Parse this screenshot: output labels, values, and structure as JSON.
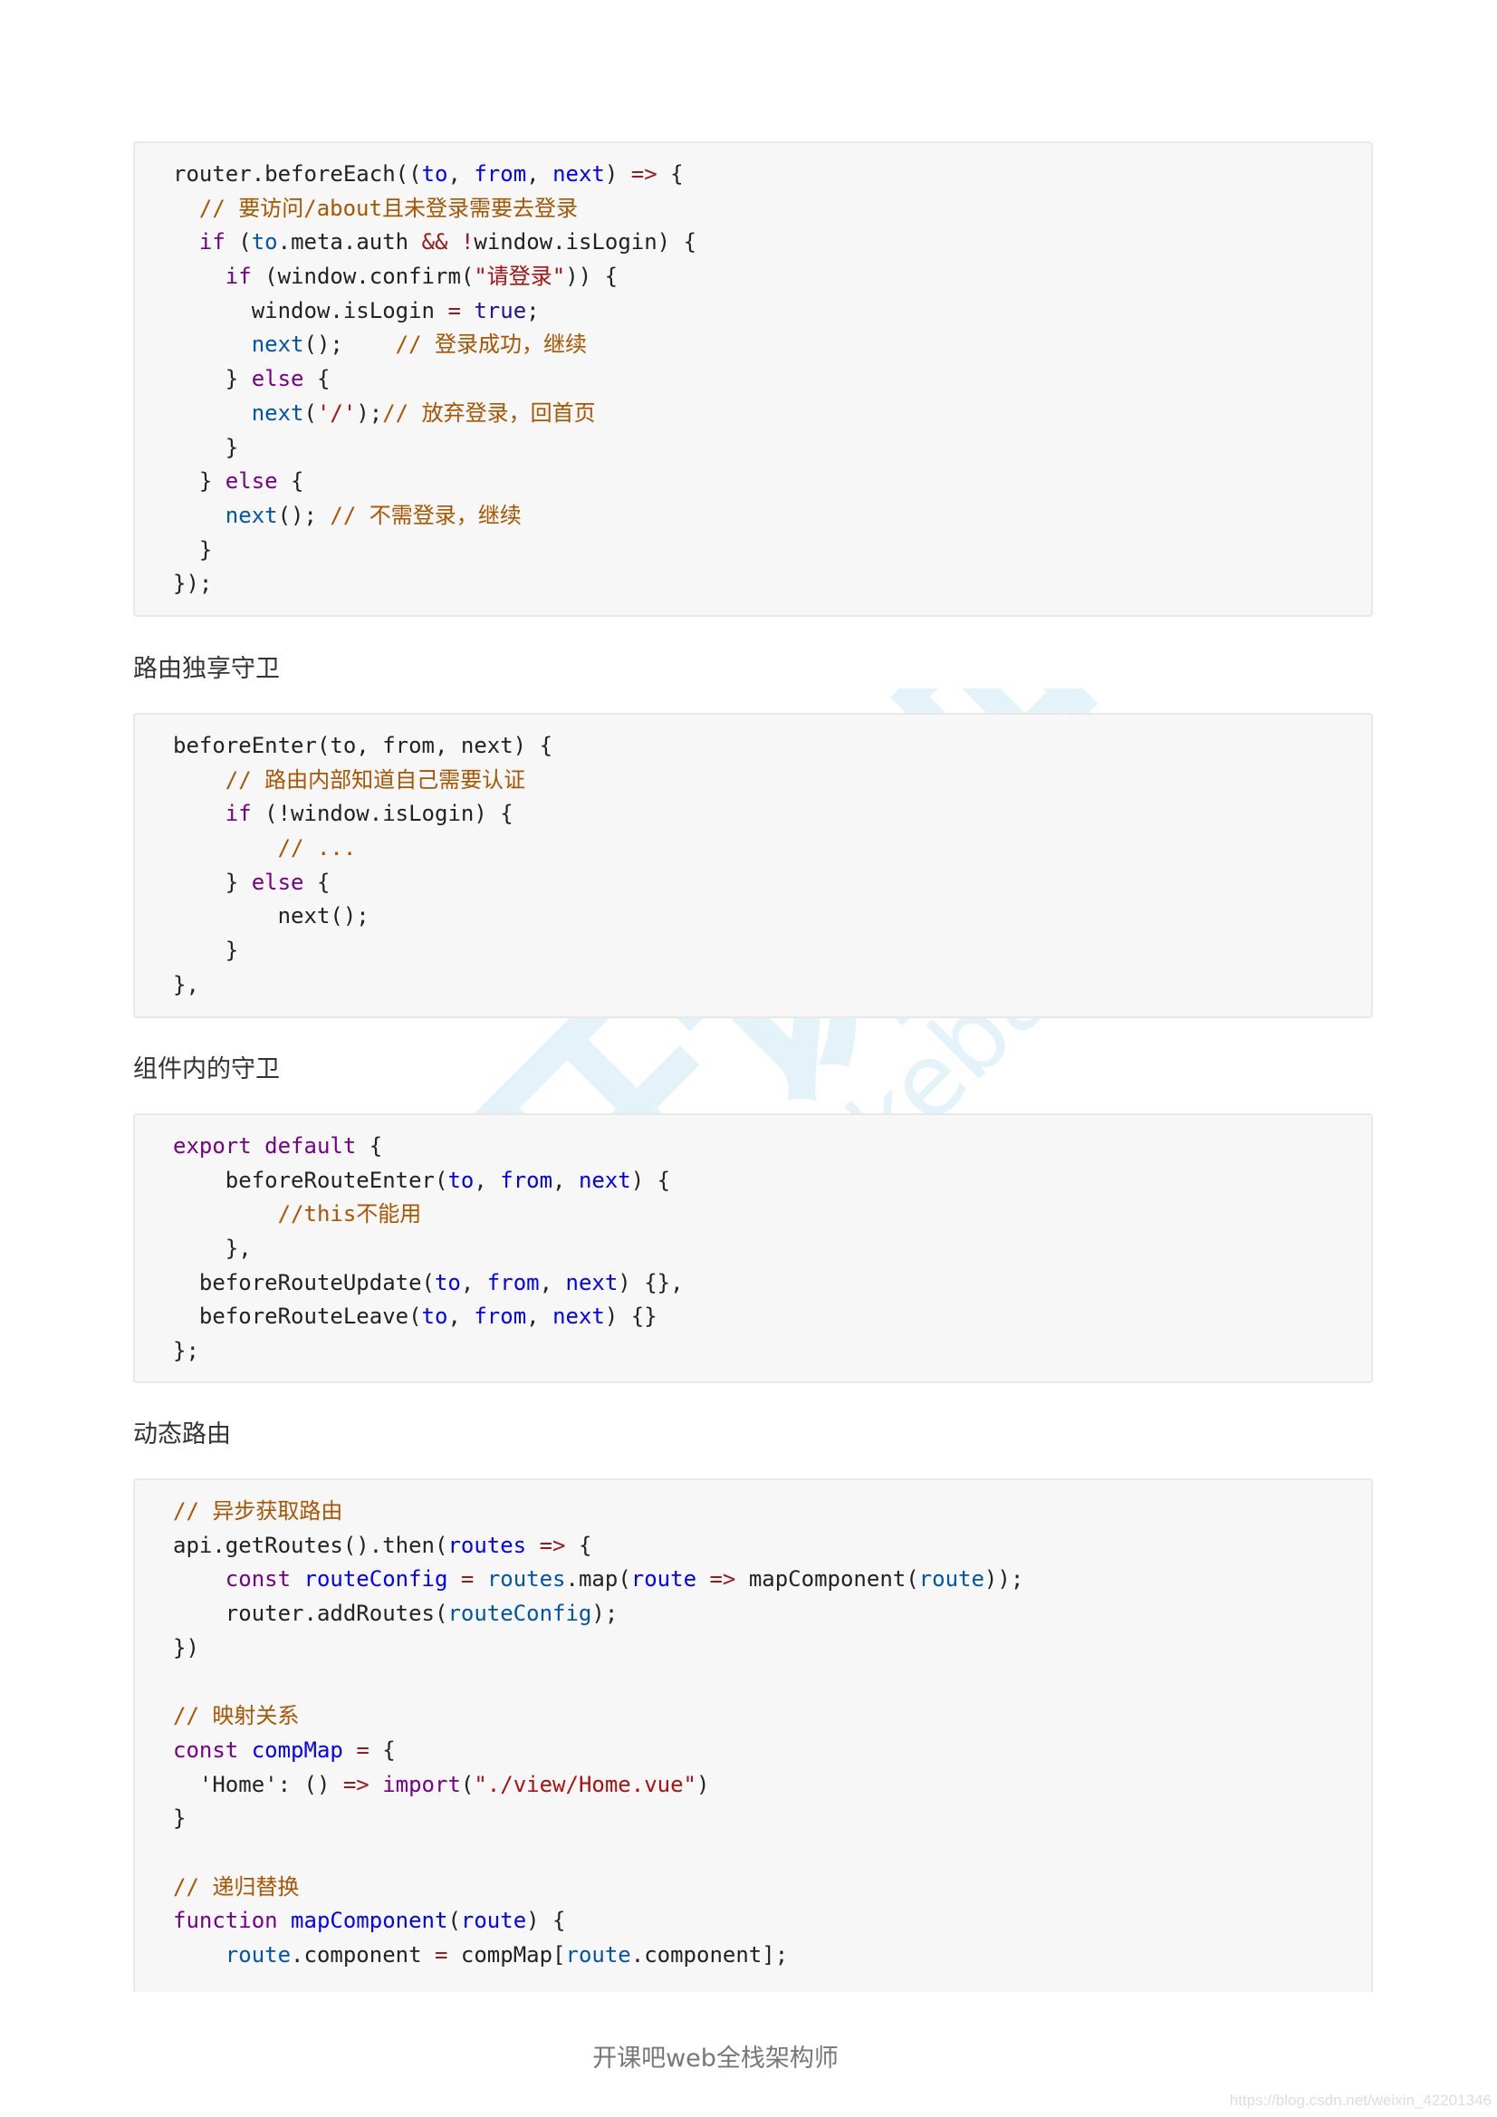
{
  "watermark": {
    "brand": "开课吧",
    "domain": "kaikeba.com",
    "color": "#cfe8f6"
  },
  "headings": [
    "路由独享守卫",
    "组件内的守卫",
    "动态路由"
  ],
  "footer": {
    "title": "开课吧web全栈架构师",
    "source": "https://blog.csdn.net/weixin_42201346"
  },
  "code_blocks": [
    [
      [
        [
          "plain",
          "router.beforeEach(("
        ],
        [
          "def",
          "to"
        ],
        [
          "plain",
          ", "
        ],
        [
          "def",
          "from"
        ],
        [
          "plain",
          ", "
        ],
        [
          "def",
          "next"
        ],
        [
          "plain",
          ") "
        ],
        [
          "op",
          "=>"
        ],
        [
          "plain",
          " {"
        ]
      ],
      [
        [
          "plain",
          "  "
        ],
        [
          "cm",
          "// 要访问/about且未登录需要去登录"
        ]
      ],
      [
        [
          "plain",
          "  "
        ],
        [
          "kw",
          "if"
        ],
        [
          "plain",
          " ("
        ],
        [
          "v2",
          "to"
        ],
        [
          "plain",
          ".meta.auth "
        ],
        [
          "op",
          "&&"
        ],
        [
          "plain",
          " "
        ],
        [
          "op",
          "!"
        ],
        [
          "plain",
          "window.isLogin) {"
        ]
      ],
      [
        [
          "plain",
          "    "
        ],
        [
          "kw",
          "if"
        ],
        [
          "plain",
          " (window.confirm("
        ],
        [
          "str",
          "\"请登录\""
        ],
        [
          "plain",
          ")) {"
        ]
      ],
      [
        [
          "plain",
          "      window.isLogin "
        ],
        [
          "op",
          "="
        ],
        [
          "plain",
          " "
        ],
        [
          "atom",
          "true"
        ],
        [
          "plain",
          ";"
        ]
      ],
      [
        [
          "plain",
          "      "
        ],
        [
          "v2",
          "next"
        ],
        [
          "plain",
          "();    "
        ],
        [
          "cm",
          "// 登录成功，继续"
        ]
      ],
      [
        [
          "plain",
          "    } "
        ],
        [
          "kw",
          "else"
        ],
        [
          "plain",
          " {"
        ]
      ],
      [
        [
          "plain",
          "      "
        ],
        [
          "v2",
          "next"
        ],
        [
          "plain",
          "("
        ],
        [
          "str",
          "'/'"
        ],
        [
          "plain",
          ");"
        ],
        [
          "cm",
          "// 放弃登录，回首页"
        ]
      ],
      [
        [
          "plain",
          "    }"
        ]
      ],
      [
        [
          "plain",
          "  } "
        ],
        [
          "kw",
          "else"
        ],
        [
          "plain",
          " {"
        ]
      ],
      [
        [
          "plain",
          "    "
        ],
        [
          "v2",
          "next"
        ],
        [
          "plain",
          "(); "
        ],
        [
          "cm",
          "// 不需登录，继续"
        ]
      ],
      [
        [
          "plain",
          "  }"
        ]
      ],
      [
        [
          "plain",
          "});"
        ]
      ]
    ],
    [
      [
        [
          "plain",
          "beforeEnter(to, from, next) {"
        ]
      ],
      [
        [
          "plain",
          "    "
        ],
        [
          "cm",
          "// 路由内部知道自己需要认证"
        ]
      ],
      [
        [
          "plain",
          "    "
        ],
        [
          "kw",
          "if"
        ],
        [
          "plain",
          " (!window.isLogin) {"
        ]
      ],
      [
        [
          "plain",
          "        "
        ],
        [
          "cm",
          "// ..."
        ]
      ],
      [
        [
          "plain",
          "    } "
        ],
        [
          "kw",
          "else"
        ],
        [
          "plain",
          " {"
        ]
      ],
      [
        [
          "plain",
          "        next();"
        ]
      ],
      [
        [
          "plain",
          "    }"
        ]
      ],
      [
        [
          "plain",
          "},"
        ]
      ]
    ],
    [
      [
        [
          "kw",
          "export"
        ],
        [
          "plain",
          " "
        ],
        [
          "kw",
          "default"
        ],
        [
          "plain",
          " {"
        ]
      ],
      [
        [
          "plain",
          "    beforeRouteEnter("
        ],
        [
          "def",
          "to"
        ],
        [
          "plain",
          ", "
        ],
        [
          "def",
          "from"
        ],
        [
          "plain",
          ", "
        ],
        [
          "def",
          "next"
        ],
        [
          "plain",
          ") {"
        ]
      ],
      [
        [
          "plain",
          "        "
        ],
        [
          "cm",
          "//this不能用"
        ]
      ],
      [
        [
          "plain",
          "    },"
        ]
      ],
      [
        [
          "plain",
          "  beforeRouteUpdate("
        ],
        [
          "def",
          "to"
        ],
        [
          "plain",
          ", "
        ],
        [
          "def",
          "from"
        ],
        [
          "plain",
          ", "
        ],
        [
          "def",
          "next"
        ],
        [
          "plain",
          ") {},"
        ]
      ],
      [
        [
          "plain",
          "  beforeRouteLeave("
        ],
        [
          "def",
          "to"
        ],
        [
          "plain",
          ", "
        ],
        [
          "def",
          "from"
        ],
        [
          "plain",
          ", "
        ],
        [
          "def",
          "next"
        ],
        [
          "plain",
          ") {}"
        ]
      ],
      [
        [
          "plain",
          "};"
        ]
      ]
    ],
    [
      [
        [
          "cm",
          "// 异步获取路由"
        ]
      ],
      [
        [
          "plain",
          "api.getRoutes().then("
        ],
        [
          "def",
          "routes"
        ],
        [
          "plain",
          " "
        ],
        [
          "op",
          "=>"
        ],
        [
          "plain",
          " {"
        ]
      ],
      [
        [
          "plain",
          "    "
        ],
        [
          "kw",
          "const"
        ],
        [
          "plain",
          " "
        ],
        [
          "def",
          "routeConfig"
        ],
        [
          "plain",
          " "
        ],
        [
          "op",
          "="
        ],
        [
          "plain",
          " "
        ],
        [
          "v2",
          "routes"
        ],
        [
          "plain",
          ".map("
        ],
        [
          "def",
          "route"
        ],
        [
          "plain",
          " "
        ],
        [
          "op",
          "=>"
        ],
        [
          "plain",
          " mapComponent("
        ],
        [
          "v2",
          "route"
        ],
        [
          "plain",
          "));"
        ]
      ],
      [
        [
          "plain",
          "    router.addRoutes("
        ],
        [
          "v2",
          "routeConfig"
        ],
        [
          "plain",
          ");"
        ]
      ],
      [
        [
          "plain",
          "})"
        ]
      ],
      [
        [
          "plain",
          ""
        ]
      ],
      [
        [
          "cm",
          "// 映射关系"
        ]
      ],
      [
        [
          "kw",
          "const"
        ],
        [
          "plain",
          " "
        ],
        [
          "def",
          "compMap"
        ],
        [
          "plain",
          " "
        ],
        [
          "op",
          "="
        ],
        [
          "plain",
          " {"
        ]
      ],
      [
        [
          "plain",
          "  'Home': () "
        ],
        [
          "op",
          "=>"
        ],
        [
          "plain",
          " "
        ],
        [
          "kw",
          "import"
        ],
        [
          "plain",
          "("
        ],
        [
          "str",
          "\"./view/Home.vue\""
        ],
        [
          "plain",
          ")"
        ]
      ],
      [
        [
          "plain",
          "}"
        ]
      ],
      [
        [
          "plain",
          ""
        ]
      ],
      [
        [
          "cm",
          "// 递归替换"
        ]
      ],
      [
        [
          "kw",
          "function"
        ],
        [
          "plain",
          " "
        ],
        [
          "def",
          "mapComponent"
        ],
        [
          "plain",
          "("
        ],
        [
          "def",
          "route"
        ],
        [
          "plain",
          ") {"
        ]
      ],
      [
        [
          "plain",
          "    "
        ],
        [
          "v2",
          "route"
        ],
        [
          "plain",
          ".component "
        ],
        [
          "op",
          "="
        ],
        [
          "plain",
          " compMap["
        ],
        [
          "v2",
          "route"
        ],
        [
          "plain",
          ".component];"
        ]
      ]
    ]
  ]
}
